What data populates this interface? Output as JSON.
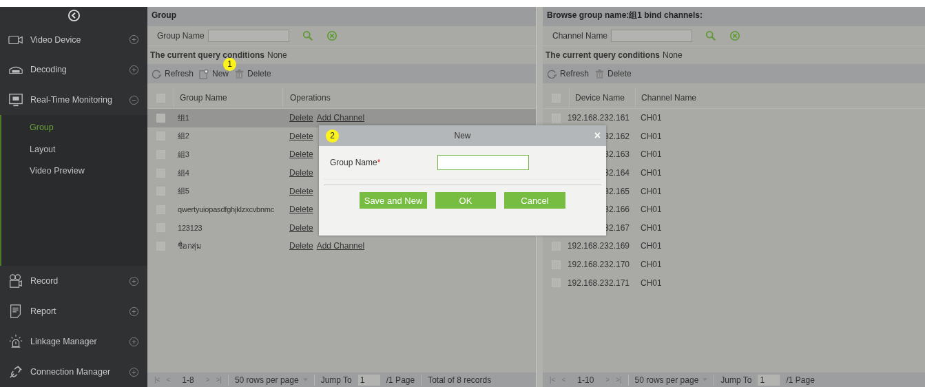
{
  "sidebar": {
    "items": [
      {
        "label": "Video Device",
        "expanded": false
      },
      {
        "label": "Decoding",
        "expanded": false
      },
      {
        "label": "Real-Time Monitoring",
        "expanded": true,
        "children": [
          {
            "label": "Group",
            "selected": true
          },
          {
            "label": "Layout",
            "selected": false
          },
          {
            "label": "Video Preview",
            "selected": false
          }
        ]
      },
      {
        "label": "Record",
        "expanded": false
      },
      {
        "label": "Report",
        "expanded": false
      },
      {
        "label": "Linkage Manager",
        "expanded": false
      },
      {
        "label": "Connection Manager",
        "expanded": false
      }
    ]
  },
  "left_panel": {
    "title": "Group",
    "search_label": "Group Name",
    "query_label": "The current query conditions",
    "query_value": "None",
    "toolbar": [
      {
        "kind": "refresh",
        "label": "Refresh"
      },
      {
        "kind": "new",
        "label": "New",
        "badge": "1"
      },
      {
        "kind": "delete",
        "label": "Delete"
      }
    ],
    "all_checked": false,
    "columns": [
      "Group Name",
      "Operations"
    ],
    "rows": [
      {
        "name": "组1",
        "selected": true,
        "checked": false,
        "actions": [
          "Delete",
          "Add Channel"
        ]
      },
      {
        "name": "組2",
        "selected": false,
        "checked": false,
        "actions": [
          "Delete"
        ]
      },
      {
        "name": "組3",
        "selected": false,
        "checked": false,
        "actions": [
          "Delete"
        ]
      },
      {
        "name": "組4",
        "selected": false,
        "checked": false,
        "actions": [
          "Delete"
        ]
      },
      {
        "name": "組5",
        "selected": false,
        "checked": false,
        "actions": [
          "Delete"
        ]
      },
      {
        "name": "qwertyuiopasdfghjklzxcvbnmc",
        "selected": false,
        "checked": false,
        "actions": [
          "Delete"
        ]
      },
      {
        "name": "123123",
        "selected": false,
        "checked": false,
        "actions": [
          "Delete"
        ]
      },
      {
        "name": "ชื่อกลุ่ม",
        "selected": false,
        "checked": false,
        "actions": [
          "Delete",
          "Add Channel"
        ]
      }
    ],
    "pager": {
      "first": "|<",
      "prev": "<",
      "range": "1-8",
      "next": ">",
      "last": ">|",
      "per_page": "50 rows per page",
      "jump_label": "Jump To",
      "jump_value": "1",
      "pages": "/1 Page",
      "total": "Total of 8 records"
    }
  },
  "right_panel": {
    "title": "Browse group name:组1 bind channels:",
    "search_label": "Channel Name",
    "query_label": "The current query conditions",
    "query_value": "None",
    "toolbar": [
      {
        "kind": "refresh",
        "label": "Refresh"
      },
      {
        "kind": "delete",
        "label": "Delete"
      }
    ],
    "all_checked": false,
    "columns": [
      "Device Name",
      "Channel Name"
    ],
    "rows": [
      {
        "device": "192.168.232.161",
        "channel": "CH01",
        "checked": false
      },
      {
        "device": "32.162",
        "channel": "CH01"
      },
      {
        "device": "32.163",
        "channel": "CH01"
      },
      {
        "device": "32.164",
        "channel": "CH01"
      },
      {
        "device": "32.165",
        "channel": "CH01"
      },
      {
        "device": "32.166",
        "channel": "CH01"
      },
      {
        "device": "32.167",
        "channel": "CH01"
      },
      {
        "device": "192.168.232.169",
        "channel": "CH01",
        "checked": false
      },
      {
        "device": "192.168.232.170",
        "channel": "CH01",
        "checked": false
      },
      {
        "device": "192.168.232.171",
        "channel": "CH01",
        "checked": false
      }
    ],
    "pager": {
      "first": "|<",
      "prev": "<",
      "range": "1-10",
      "next": ">",
      "last": ">|",
      "per_page": "50 rows per page",
      "jump_label": "Jump To",
      "jump_value": "1",
      "pages": "/1 Page"
    }
  },
  "dialog": {
    "badge": "2",
    "title": "New",
    "close": "×",
    "field_label": "Group Name",
    "required_mark": "*",
    "buttons": [
      "Save and New",
      "OK",
      "Cancel"
    ]
  }
}
